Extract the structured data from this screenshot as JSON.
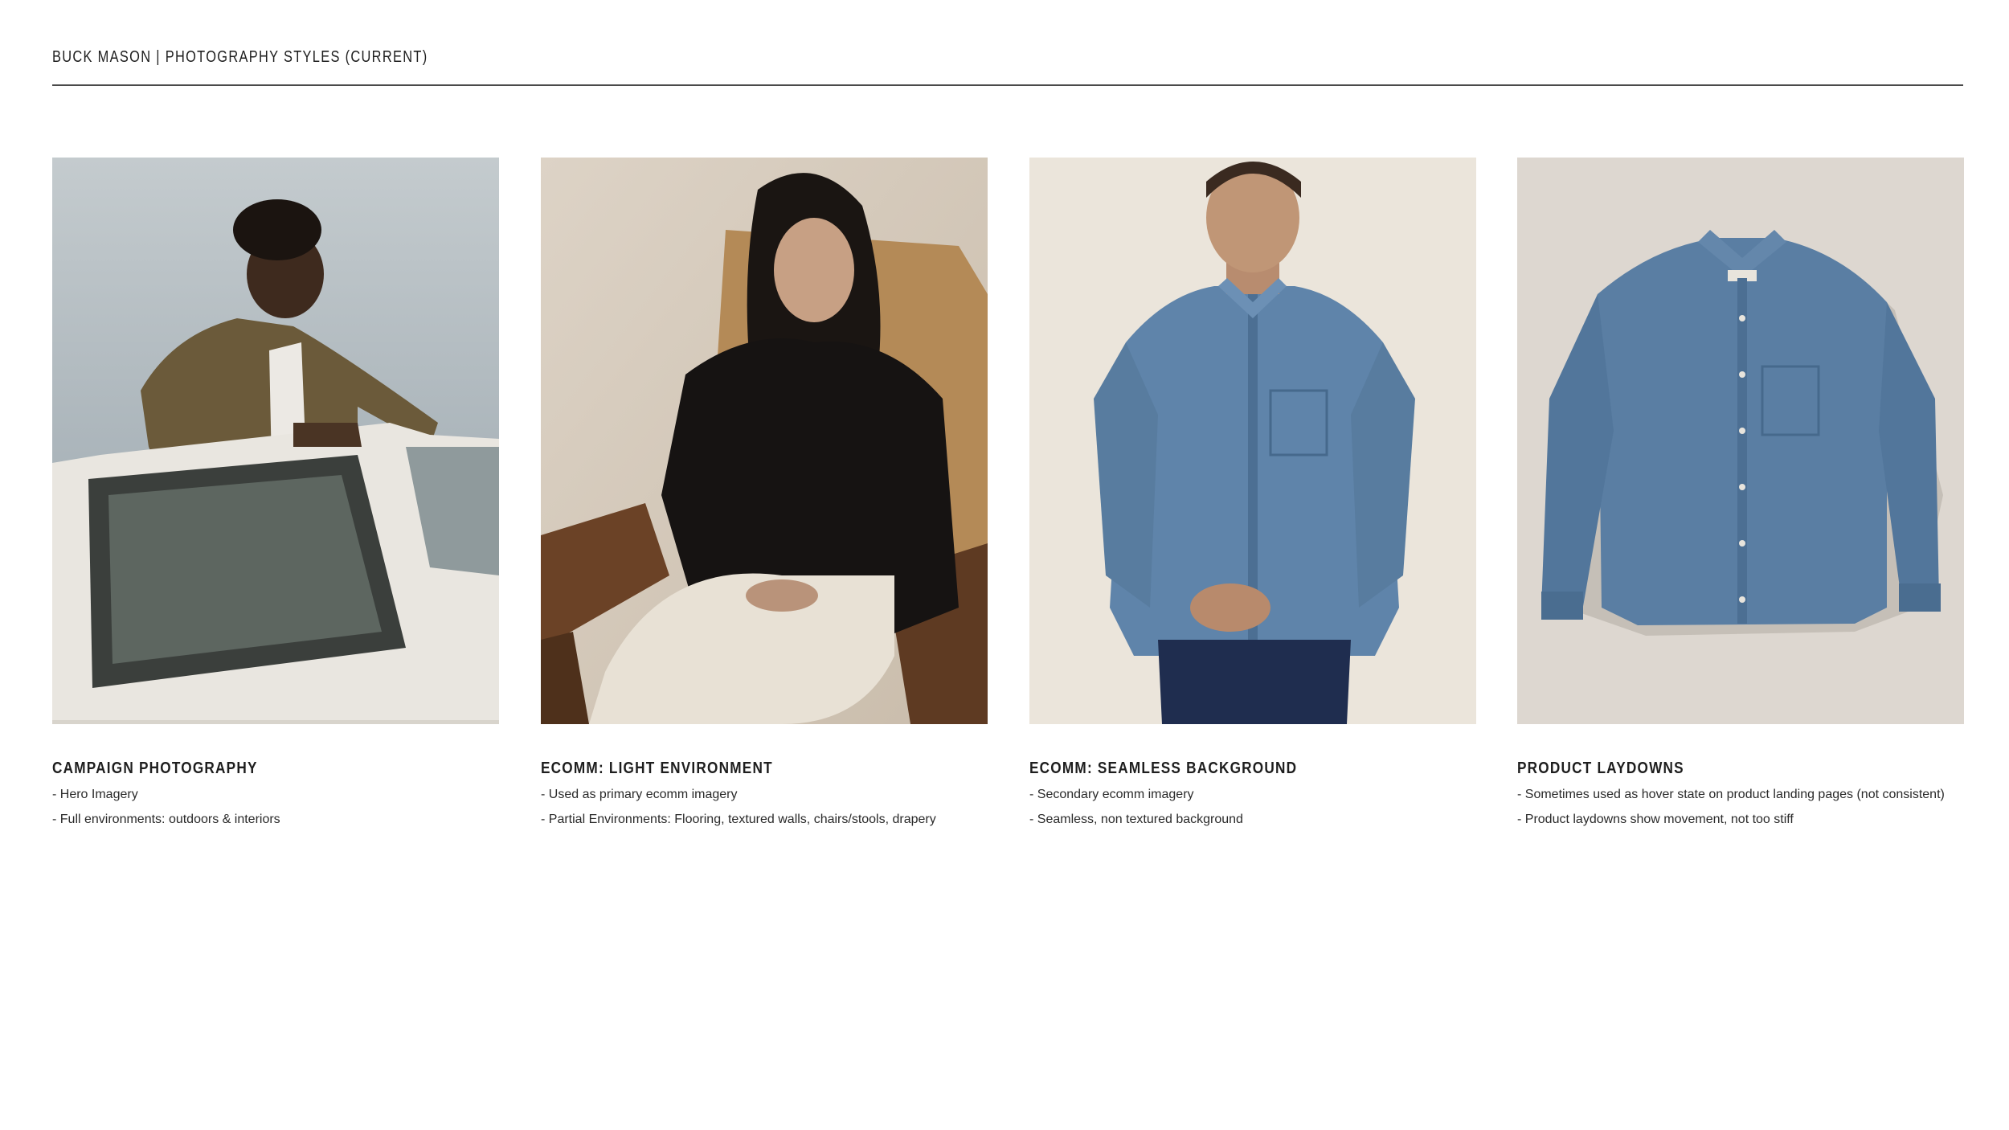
{
  "header": {
    "title": "BUCK MASON | PHOTOGRAPHY STYLES (CURRENT)"
  },
  "styles": [
    {
      "title": "CAMPAIGN PHOTOGRAPHY",
      "lines": [
        "- Hero Imagery",
        "- Full environments: outdoors & interiors"
      ],
      "image": "man-in-olive-jacket-leaning-on-white-truck-door-photo"
    },
    {
      "title": "ECOMM: LIGHT ENVIRONMENT",
      "lines": [
        "- Used as primary ecomm imagery",
        "- Partial Environments: Flooring, textured walls, chairs/stools, drapery"
      ],
      "image": "woman-in-black-jacket-seated-in-wooden-chair-photo"
    },
    {
      "title": "ECOMM: SEAMLESS BACKGROUND",
      "lines": [
        "- Secondary ecomm imagery",
        "- Seamless, non textured background"
      ],
      "image": "man-in-denim-shirt-seamless-background-photo"
    },
    {
      "title": "PRODUCT LAYDOWNS",
      "lines": [
        "- Sometimes used as hover state on product landing pages (not consistent)",
        "- Product laydowns show movement, not too stiff"
      ],
      "image": "denim-shirt-laydown-photo"
    }
  ],
  "colors": {
    "rule": "#4a4a4a",
    "text": "#1e1e1e",
    "campaign_sky": "#b9c1c4",
    "light_env_wall": "#d9cfc2",
    "seamless_bg": "#ece6dc",
    "laydown_bg": "#ddd7d0",
    "denim": "#5a7ea3"
  }
}
